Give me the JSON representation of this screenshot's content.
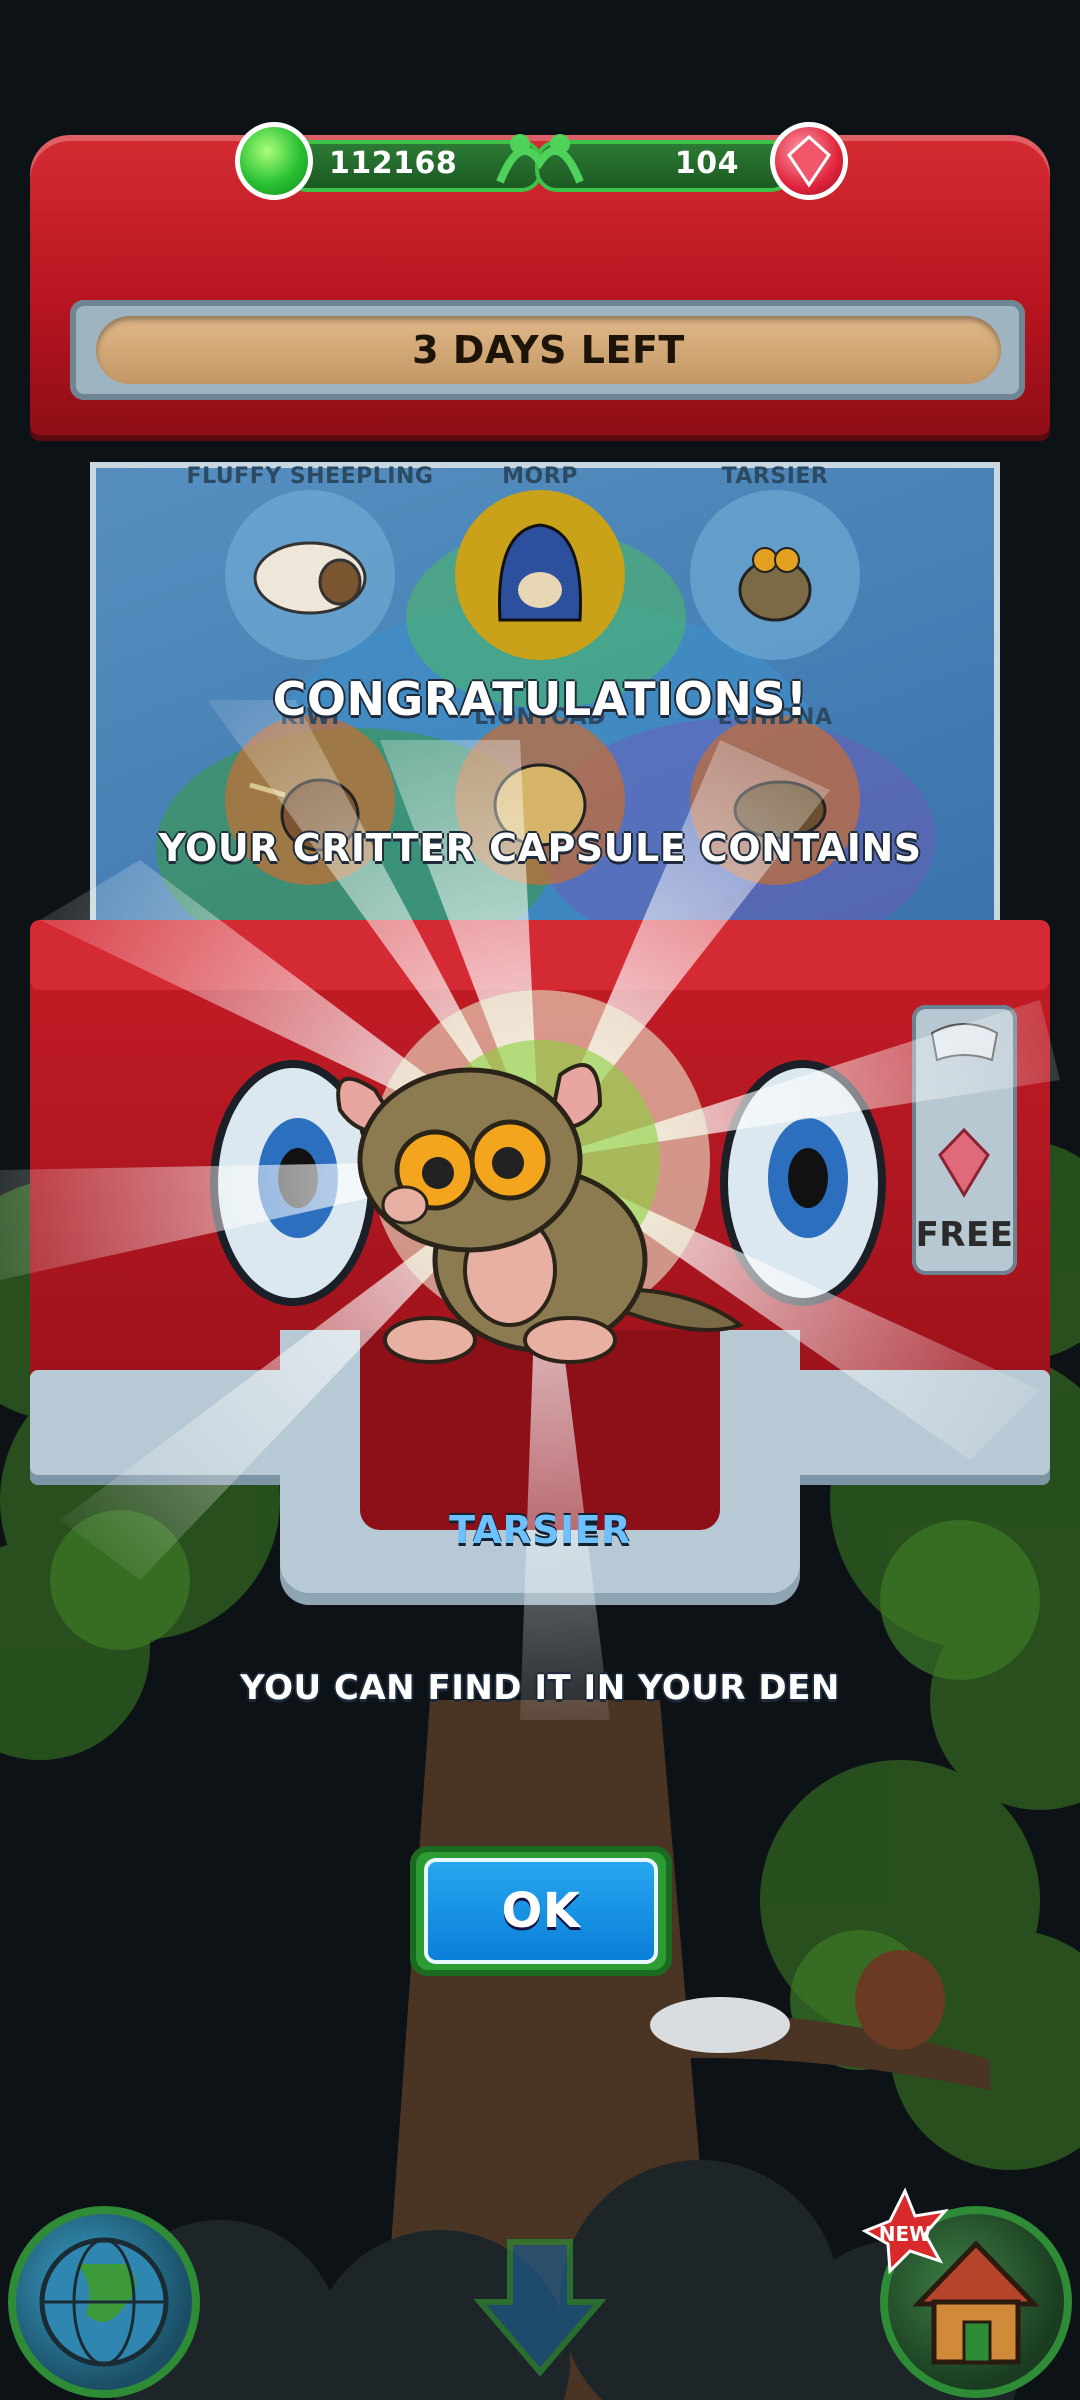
{
  "currency": {
    "green": "112168",
    "red": "104"
  },
  "banner": "3 DAYS LEFT",
  "critters": [
    {
      "name": "FLUFFY SHEEPLING"
    },
    {
      "name": "MORP"
    },
    {
      "name": "TARSIER"
    },
    {
      "name": "KIWI"
    },
    {
      "name": "LIONTOAD"
    },
    {
      "name": "ECHIDNA"
    }
  ],
  "reward": {
    "title": "CONGRATULATIONS!",
    "subtitle": "YOUR CRITTER CAPSULE CONTAINS",
    "critter_name": "TARSIER",
    "message": "YOU CAN FIND IT IN YOUR DEN",
    "ok_label": "OK"
  },
  "machine": {
    "free_label": "FREE"
  },
  "nav": {
    "new_badge": "NEW"
  },
  "colors": {
    "machine_red": "#c61d27",
    "ok_blue": "#0a7fd8",
    "accent_green": "#2d9c32",
    "critter_name": "#6ec1ff"
  }
}
